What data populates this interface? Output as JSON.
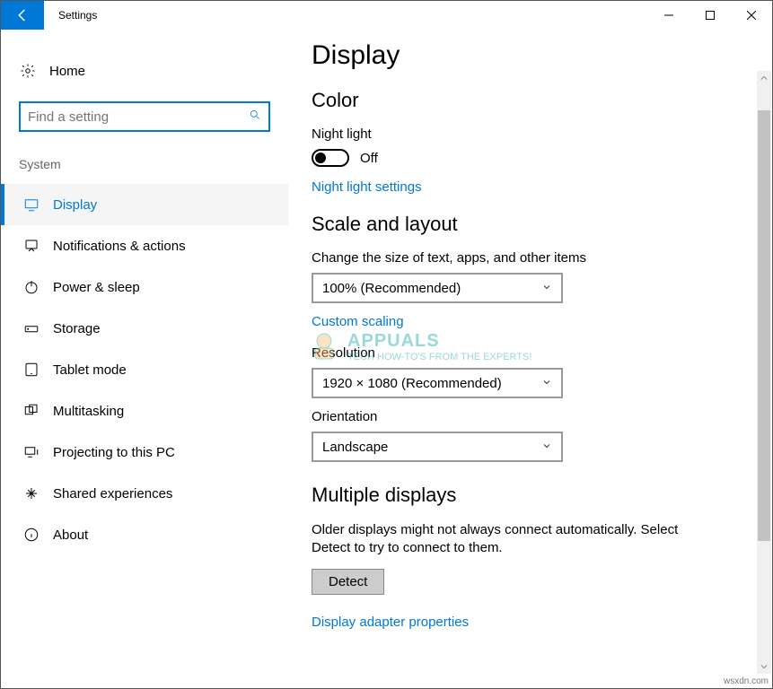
{
  "window": {
    "title": "Settings"
  },
  "sidebar": {
    "home": "Home",
    "search_placeholder": "Find a setting",
    "group": "System",
    "items": [
      {
        "label": "Display"
      },
      {
        "label": "Notifications & actions"
      },
      {
        "label": "Power & sleep"
      },
      {
        "label": "Storage"
      },
      {
        "label": "Tablet mode"
      },
      {
        "label": "Multitasking"
      },
      {
        "label": "Projecting to this PC"
      },
      {
        "label": "Shared experiences"
      },
      {
        "label": "About"
      }
    ]
  },
  "page": {
    "title": "Display",
    "color": {
      "heading": "Color",
      "nightlight_label": "Night light",
      "nightlight_state": "Off",
      "link": "Night light settings"
    },
    "scale": {
      "heading": "Scale and layout",
      "size_label": "Change the size of text, apps, and other items",
      "size_value": "100% (Recommended)",
      "custom_link": "Custom scaling",
      "resolution_label": "Resolution",
      "resolution_value": "1920 × 1080 (Recommended)",
      "orientation_label": "Orientation",
      "orientation_value": "Landscape"
    },
    "multi": {
      "heading": "Multiple displays",
      "help": "Older displays might not always connect automatically. Select Detect to try to connect to them.",
      "detect": "Detect",
      "adapter_link": "Display adapter properties"
    }
  },
  "watermark": {
    "brand": "APPUALS",
    "tag": "TECH HOW-TO'S FROM THE EXPERTS!"
  },
  "corner": "wsxdn.com"
}
